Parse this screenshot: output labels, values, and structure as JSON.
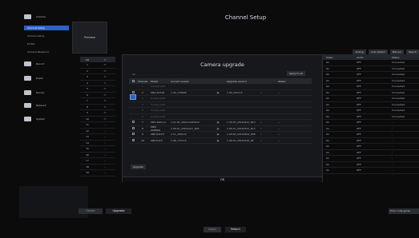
{
  "header": {
    "title": "Channel Setup"
  },
  "sidebar": {
    "items": [
      {
        "label": "Camera",
        "icon": "camera-icon"
      },
      {
        "label": "Record",
        "icon": "record-icon"
      },
      {
        "label": "Event",
        "icon": "event-icon"
      },
      {
        "label": "Device",
        "icon": "device-icon"
      },
      {
        "label": "Network",
        "icon": "network-icon"
      },
      {
        "label": "System",
        "icon": "system-icon"
      }
    ],
    "subitems": [
      "Channel Setup",
      "Camera Setup",
      "Profile",
      "Camera Password"
    ]
  },
  "background": {
    "preview_label": "Preview",
    "tabs": [
      "Analog",
      "Auto Detect",
      "Manual",
      "Search"
    ],
    "left_rows": [
      "1",
      "2",
      "3",
      "4",
      "5",
      "6",
      "7",
      "8",
      "9",
      "10",
      "11",
      "12",
      "13",
      "14",
      "15",
      "16",
      "17",
      "18",
      "19"
    ],
    "right_headers": [
      "Video",
      "Audio",
      "Status"
    ],
    "right_rows": [
      [
        "On",
        "OFF",
        "Connected"
      ],
      [
        "On",
        "OFF",
        "Connected"
      ],
      [
        "On",
        "OFF",
        "Connected"
      ],
      [
        "On",
        "OFF",
        "Connected"
      ],
      [
        "On",
        "OFF",
        "Connected"
      ],
      [
        "On",
        "OFF",
        "Connected"
      ],
      [
        "On",
        "OFF",
        "Connected"
      ],
      [
        "On",
        "OFF",
        "Connected"
      ],
      [
        "On",
        "OFF",
        "Connected"
      ],
      [
        "On",
        "OFF",
        "Connected"
      ],
      [
        "On",
        "OFF",
        "-"
      ],
      [
        "On",
        "OFF",
        "-"
      ],
      [
        "On",
        "OFF",
        "-"
      ],
      [
        "On",
        "OFF",
        "-"
      ],
      [
        "On",
        "OFF",
        "-"
      ],
      [
        "On",
        "OFF",
        "-"
      ],
      [
        "On",
        "OFF",
        "-"
      ],
      [
        "On",
        "OFF",
        "-"
      ],
      [
        "On",
        "OFF",
        "-"
      ]
    ],
    "error_button": "Error code guide",
    "bottom_left_button": "Delete",
    "bottom_upgrade_button": "Upgrade",
    "apply_button": "Apply",
    "return_button": "Return"
  },
  "dialog": {
    "title": "Camera upgrade",
    "tiny_label": "All",
    "apply_all_button": "Apply to All",
    "headers": [
      "",
      "Channel",
      "Model",
      "Current version",
      "",
      "Upgrade version",
      "",
      "Status"
    ],
    "rows": [
      [
        "",
        "1",
        "Analog CAM",
        "",
        "",
        "",
        "",
        ""
      ],
      [
        "",
        "2",
        "SNO-6011R",
        "1.00_170605",
        "",
        "1.00_221115",
        "",
        "--"
      ],
      [
        "",
        "3",
        "Analog CAM",
        "",
        "",
        "",
        "",
        ""
      ],
      [
        "",
        "4",
        "Analog CAM",
        "",
        "",
        "",
        "",
        ""
      ],
      [
        "",
        "5",
        "Analog CAM",
        "",
        "",
        "",
        "",
        ""
      ],
      [
        "",
        "6",
        "Analog CAM",
        "",
        "",
        "",
        "",
        ""
      ],
      [
        "",
        "7",
        "SNO-6001-G",
        "1.21.04_202111245016",
        "",
        "1.30.03_20190312_R13",
        "",
        "--"
      ],
      [
        "",
        "8",
        "PNM-9085RQ",
        "1.09.01_20201247_R45",
        "",
        "1.09.01_20190312_R13",
        "",
        "--"
      ],
      [
        "",
        "9",
        "SNP-6321H",
        "1.11_180124",
        "",
        "1.09.00_20190204_R48",
        "",
        "--"
      ],
      [
        "",
        "10",
        "SNP-6320",
        "1.06_171116",
        "",
        "1.09.02_20191210_R5",
        "",
        "--"
      ]
    ],
    "upgrade_button": "Upgrade",
    "ok_button": "OK"
  }
}
